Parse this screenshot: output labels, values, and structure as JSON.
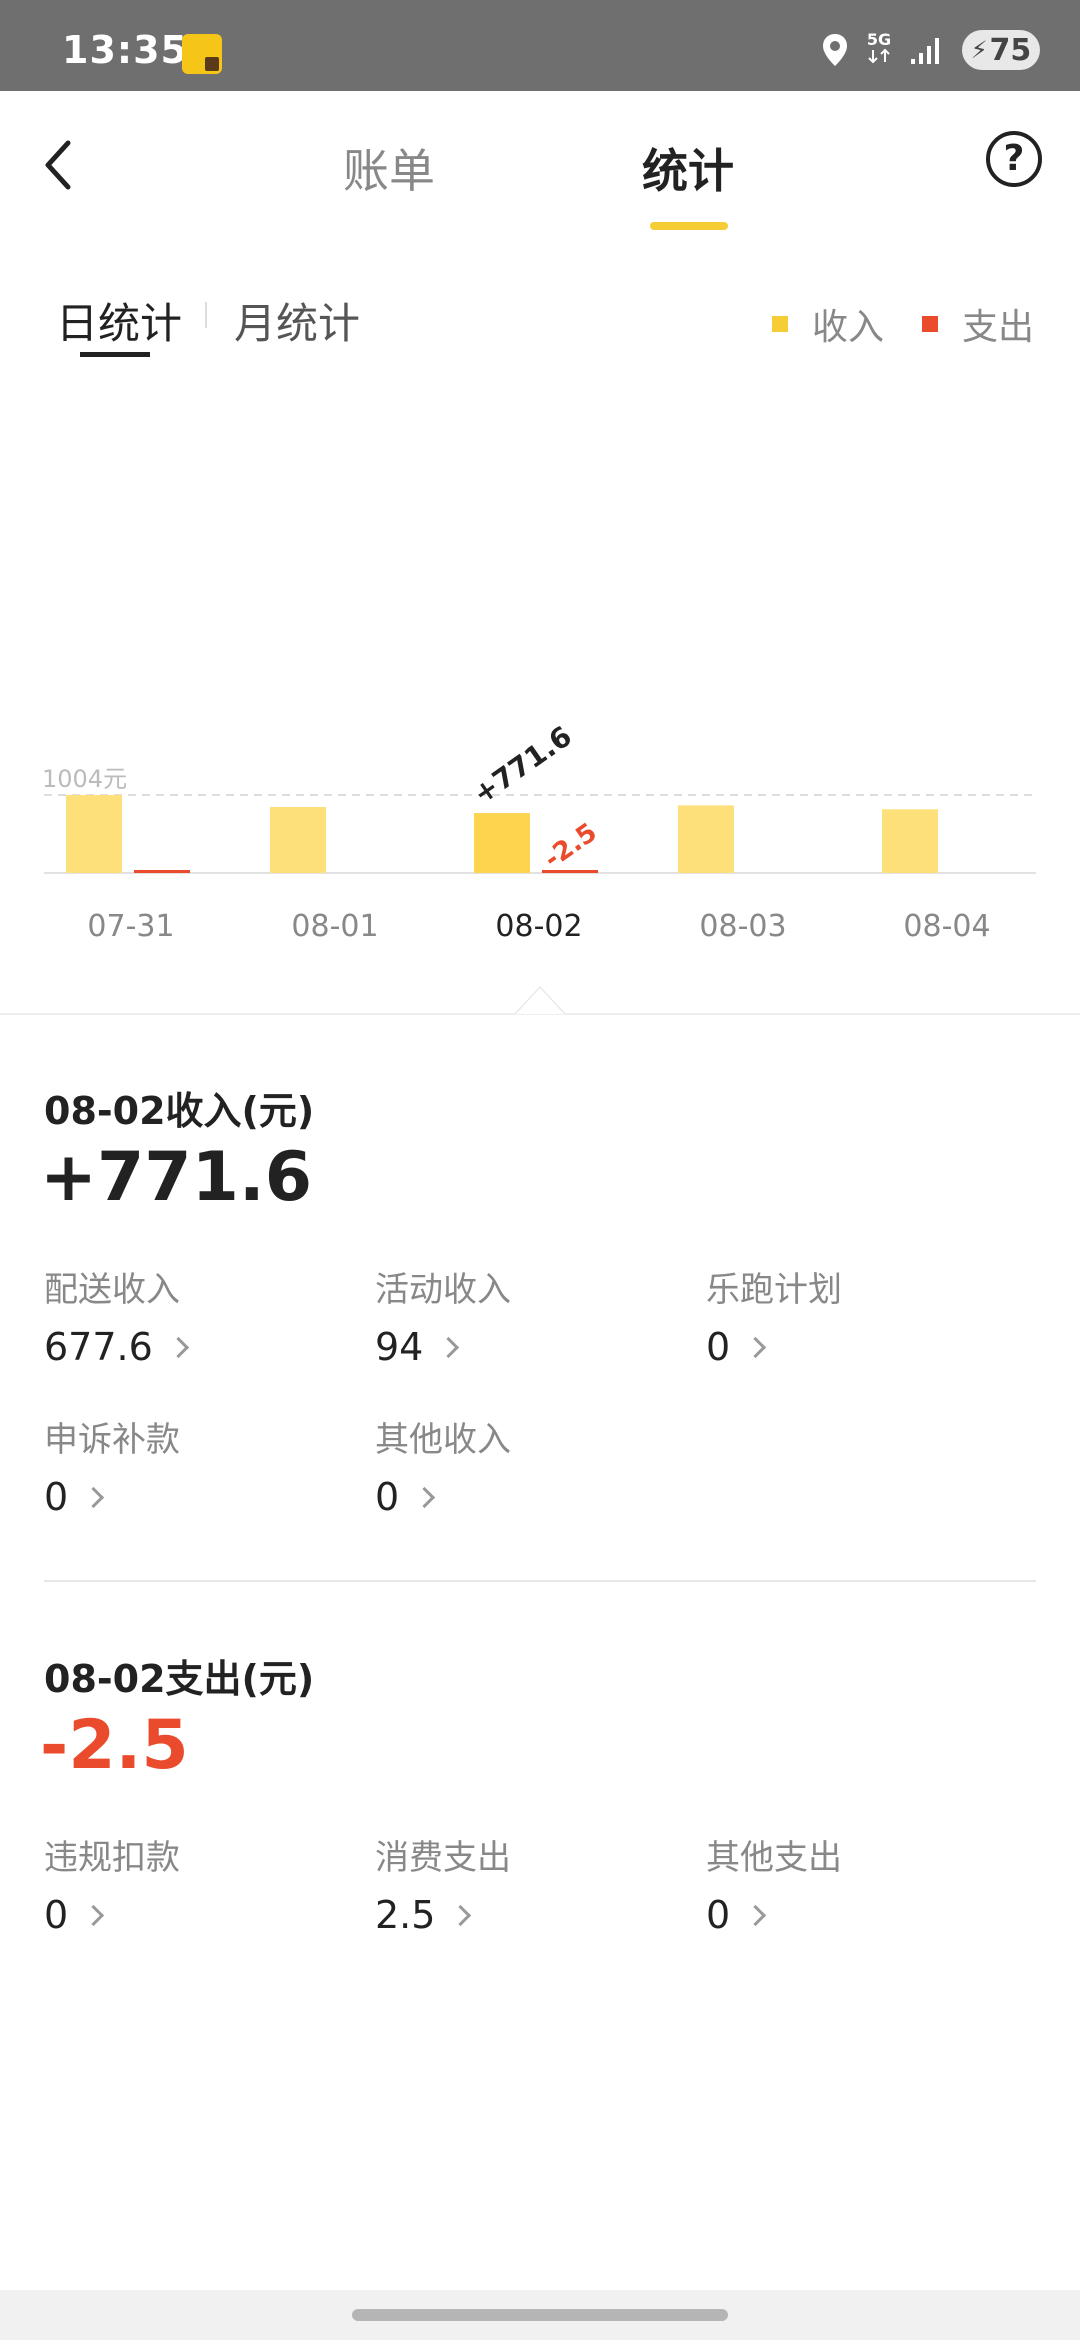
{
  "status_bar": {
    "time": "13:35",
    "network": "5G",
    "battery": "75",
    "icons": [
      "app-icon",
      "location-icon",
      "signal-icon",
      "battery-icon"
    ]
  },
  "header": {
    "tabs": [
      {
        "label": "账单",
        "active": false
      },
      {
        "label": "统计",
        "active": true
      }
    ],
    "back_icon": "chevron-left-icon",
    "help_icon": "question-circle-icon",
    "help_glyph": "?"
  },
  "sub_tabs": {
    "day": "日统计",
    "month": "月统计",
    "active": "day"
  },
  "legend": {
    "income": "收入",
    "expense": "支出",
    "income_color": "#f6cd34",
    "expense_color": "#ea4b2c"
  },
  "chart_data": {
    "type": "bar",
    "categories": [
      "07-31",
      "08-01",
      "08-02",
      "08-03",
      "08-04"
    ],
    "series": [
      {
        "name": "收入",
        "values": [
          1004,
          850,
          771.6,
          870,
          820
        ],
        "color": "#fde07a"
      },
      {
        "name": "支出",
        "values": [
          15,
          0,
          2.5,
          0,
          0
        ],
        "color": "#ea4b2c"
      }
    ],
    "selected_index": 2,
    "reference_line": {
      "value": 1004,
      "label": "1004元"
    },
    "annotations": {
      "income": "+771.6",
      "expense": "-2.5"
    }
  },
  "income_section": {
    "title": "08-02收入(元)",
    "amount": "+771.6",
    "items": [
      {
        "label": "配送收入",
        "value": "677.6"
      },
      {
        "label": "活动收入",
        "value": "94"
      },
      {
        "label": "乐跑计划",
        "value": "0"
      },
      {
        "label": "申诉补款",
        "value": "0"
      },
      {
        "label": "其他收入",
        "value": "0"
      }
    ]
  },
  "expense_section": {
    "title": "08-02支出(元)",
    "amount": "-2.5",
    "items": [
      {
        "label": "违规扣款",
        "value": "0"
      },
      {
        "label": "消费支出",
        "value": "2.5"
      },
      {
        "label": "其他支出",
        "value": "0"
      }
    ]
  }
}
